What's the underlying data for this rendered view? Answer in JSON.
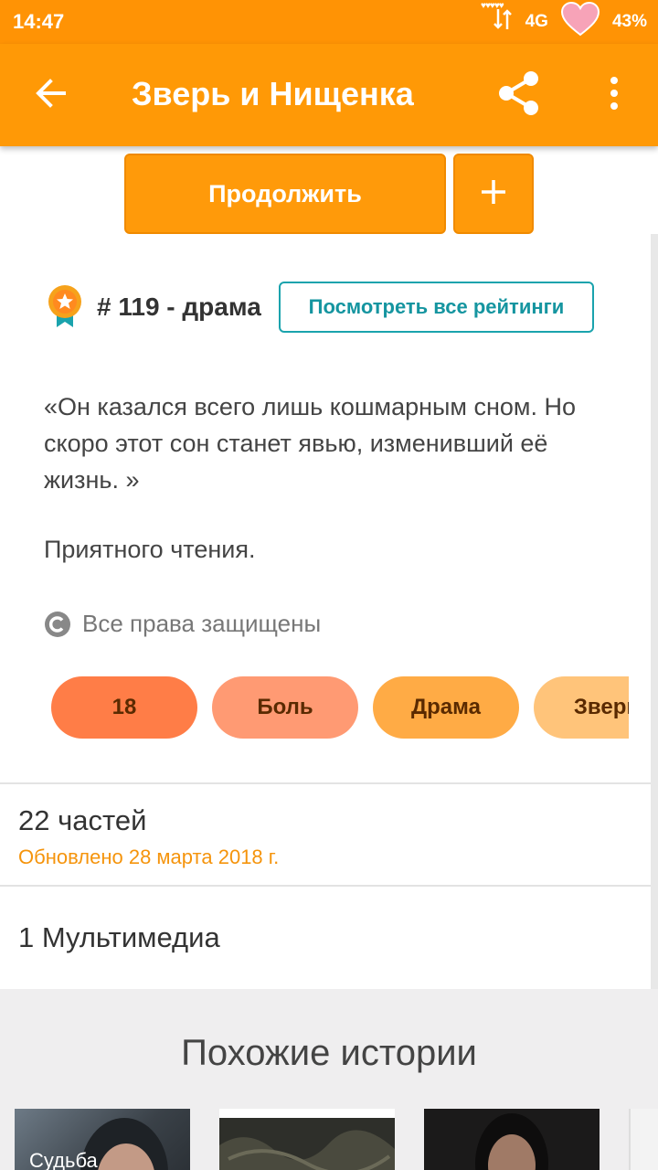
{
  "status_bar": {
    "time": "14:47",
    "network": "4G",
    "battery": "43%",
    "hearts": "♥♥♥♥♥"
  },
  "app_bar": {
    "title": "Зверь и Нищенка"
  },
  "actions": {
    "continue_label": "Продолжить",
    "add_symbol": "+"
  },
  "rank": {
    "text": "# 119 - драма",
    "ratings_button": "Посмотреть все рейтинги"
  },
  "description": {
    "quote": "«Он казался всего лишь кошмарным сном. Но скоро этот сон станет явью, изменивший её жизнь. »",
    "greeting": "Приятного чтения.",
    "copyright": "Все права защищены"
  },
  "tags": [
    {
      "label": "18",
      "color": "#ff7d47"
    },
    {
      "label": "Боль",
      "color": "#ff9a73"
    },
    {
      "label": "Драма",
      "color": "#ffab45"
    },
    {
      "label": "Зверь",
      "color": "#ffc47a"
    }
  ],
  "parts": {
    "title": "22 частей",
    "updated": "Обновлено 28 марта 2018 г."
  },
  "media": {
    "text": "1 Мультимедиа"
  },
  "similar": {
    "title": "Похожие истории",
    "items": [
      {
        "label": "Судьба"
      },
      {
        "label": ""
      },
      {
        "label": ""
      },
      {
        "label": ""
      }
    ]
  },
  "colors": {
    "accent": "#ff9906",
    "status_bar": "#ff9305",
    "teal": "#1aa3ad",
    "updated_text": "#f5940c"
  }
}
